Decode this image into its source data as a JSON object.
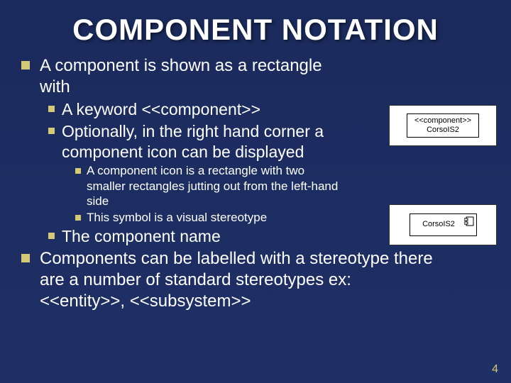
{
  "title": "COMPONENT NOTATION",
  "bullets": {
    "b1": "A component is shown as a rectangle with",
    "b1_1": "A keyword <<component>>",
    "b1_2": "Optionally, in the right hand corner a component icon can be displayed",
    "b1_2_1": "A component icon  is a rectangle with two smaller rectangles jutting out from the left-hand side",
    "b1_2_2": "This symbol is a visual stereotype",
    "b1_3": "The component name",
    "b2": "Components can be labelled with a stereotype there are a number of standard stereotypes ex: <<entity>>, <<subsystem>>"
  },
  "figures": {
    "f1_stereotype": "<<component>>",
    "f1_name": "CorsoIS2",
    "f2_name": "CorsoIS2"
  },
  "page_number": "4"
}
